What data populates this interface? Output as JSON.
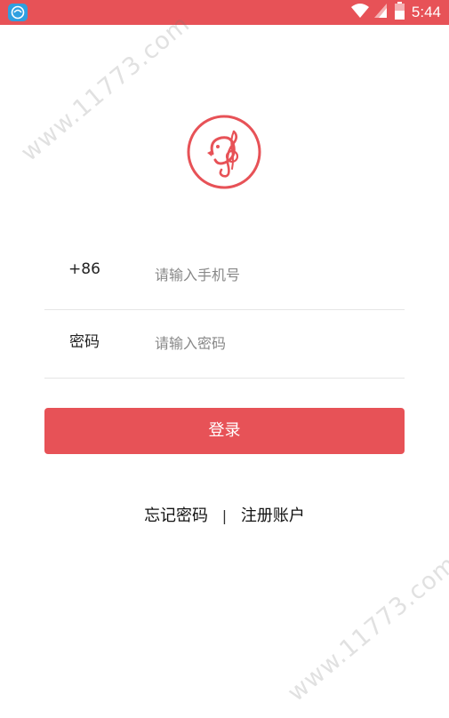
{
  "status_bar": {
    "time": "5:44",
    "color": "#e75257",
    "icons": [
      "app-icon",
      "wifi-icon",
      "signal-icon",
      "battery-icon"
    ]
  },
  "logo": {
    "icon": "music-bird-logo",
    "color": "#e75257"
  },
  "form": {
    "phone": {
      "label": "+86",
      "placeholder": "请输入手机号",
      "value": ""
    },
    "password": {
      "label": "密码",
      "placeholder": "请输入密码",
      "value": ""
    }
  },
  "login_button": {
    "label": "登录",
    "color": "#e75257"
  },
  "links": {
    "forgot_password": "忘记密码",
    "separator": "|",
    "register": "注册账户"
  },
  "watermark": {
    "text": "www.11773.com"
  }
}
